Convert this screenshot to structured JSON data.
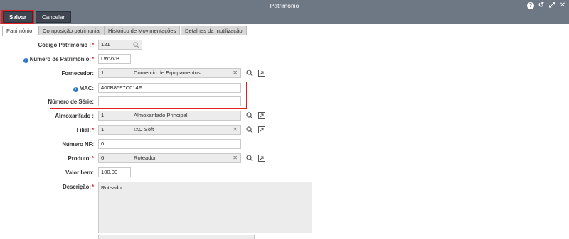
{
  "window": {
    "title": "Patrimônio"
  },
  "toolbar": {
    "save_label": "Salvar",
    "cancel_label": "Cancelar"
  },
  "tabs": [
    {
      "label": "Patrimônio",
      "active": true
    },
    {
      "label": "Composição patrimonial",
      "active": false
    },
    {
      "label": "Histórico de Movimentações",
      "active": false
    },
    {
      "label": "Detalhes da Inutilização",
      "active": false
    }
  ],
  "form": {
    "codigo": {
      "label": "Código Patrimônio :",
      "value": "121"
    },
    "numero_patrimonio": {
      "label": "Número de Patrimônio:",
      "value": "LWVVB"
    },
    "fornecedor": {
      "label": "Fornecedor:",
      "id": "1",
      "description": "Comercio de Equipamentos"
    },
    "mac": {
      "label": "MAC:",
      "value": "400B8597C014F"
    },
    "numero_serie": {
      "label": "Número de Série:",
      "value": ""
    },
    "almoxarifado": {
      "label": "Almoxarifado :",
      "id": "1",
      "description": "Almoxarifado Principal"
    },
    "filial": {
      "label": "Filial:",
      "id": "1",
      "description": "IXC Soft"
    },
    "numero_nf": {
      "label": "Número NF:",
      "value": "0"
    },
    "produto": {
      "label": "Produto:",
      "id": "6",
      "description": "Roteador"
    },
    "valor_bem": {
      "label": "Valor bem:",
      "value": "100,00"
    },
    "descricao": {
      "label": "Descrição:",
      "value": "Roteador"
    }
  },
  "icons": {
    "help": "help-icon",
    "undo": "undo-icon",
    "expand": "expand-icon",
    "close": "close-icon",
    "search": "search-icon",
    "open": "open-link-icon",
    "info": "info-icon"
  },
  "colors": {
    "titlebar": "#6e7784",
    "button": "#3f4652",
    "highlight": "#e02020",
    "info": "#2a78c2",
    "required": "#d22222"
  }
}
